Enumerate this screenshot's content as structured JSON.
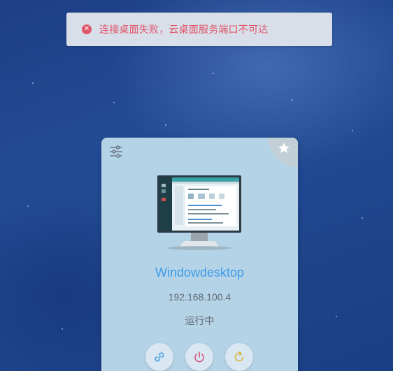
{
  "toast": {
    "icon": "close-circle-icon",
    "message": "连接桌面失败，云桌面服务端口不可达",
    "color": "#e05567"
  },
  "card": {
    "name": "Windowdesktop",
    "ip": "192.168.100.4",
    "status": "运行中",
    "icons": {
      "settings": "sliders-icon",
      "favorite": "star-icon",
      "preview": "monitor-icon"
    },
    "actions": [
      {
        "name": "connect",
        "icon": "link-icon",
        "color": "#4aa3df"
      },
      {
        "name": "power",
        "icon": "power-icon",
        "color": "#d9567a"
      },
      {
        "name": "restart",
        "icon": "refresh-icon",
        "color": "#d6b430"
      }
    ],
    "name_color": "#3d9be9"
  }
}
